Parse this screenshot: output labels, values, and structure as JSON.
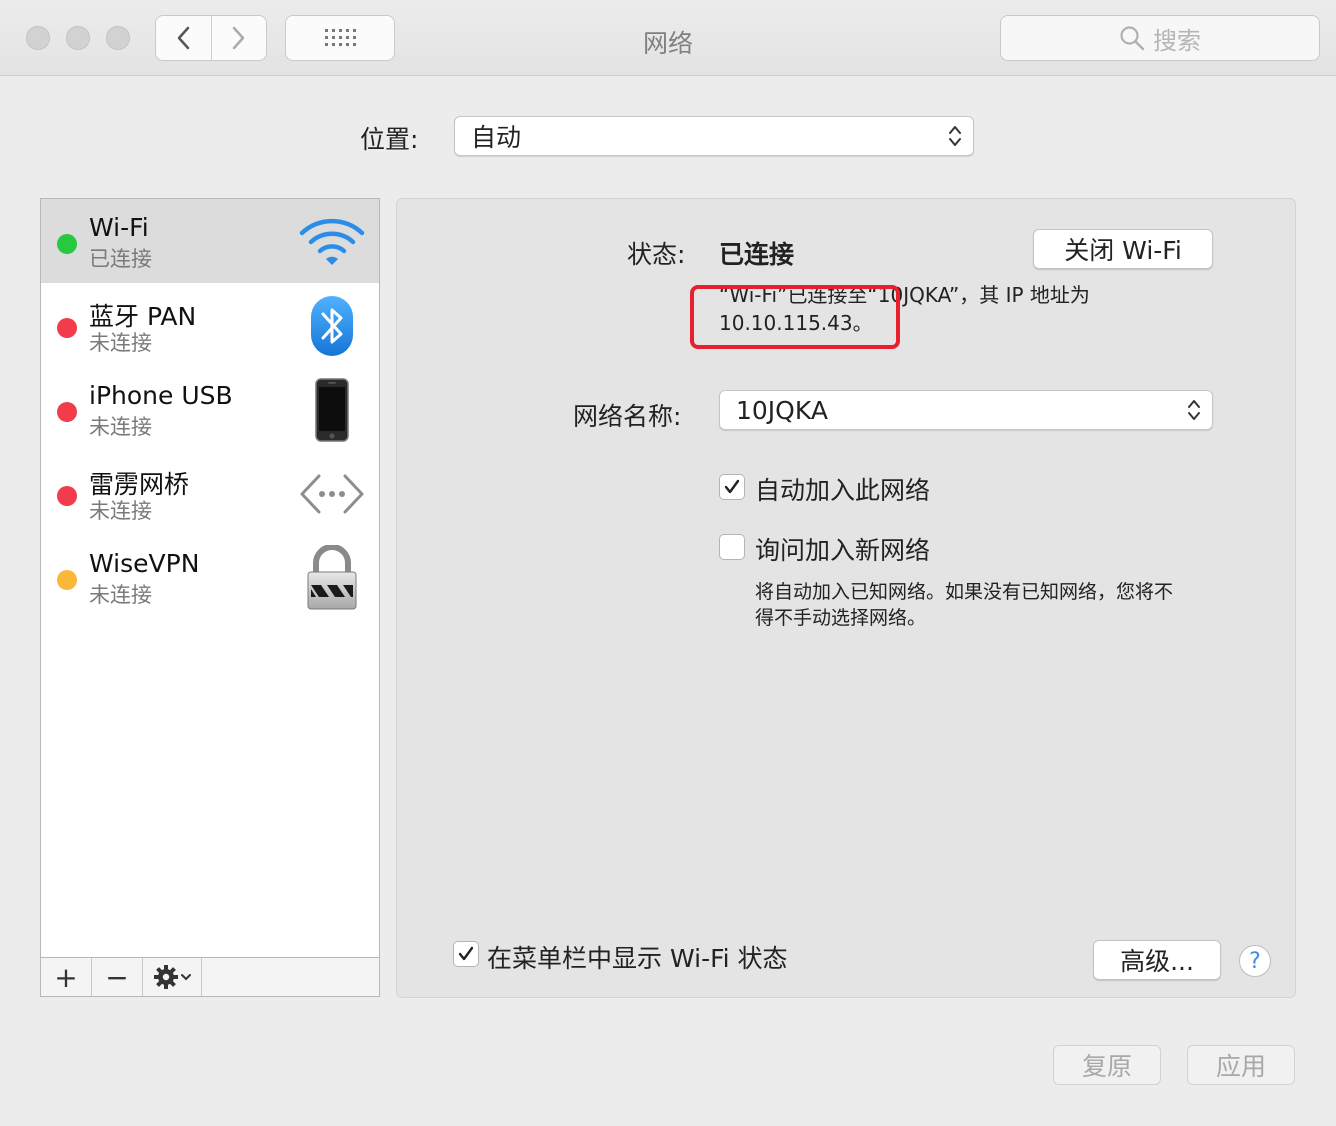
{
  "window": {
    "title": "网络",
    "search_placeholder": "搜索"
  },
  "location": {
    "label": "位置:",
    "value": "自动"
  },
  "services": [
    {
      "name": "Wi-Fi",
      "status": "已连接",
      "color": "#28c840",
      "icon": "wifi-icon",
      "selected": true
    },
    {
      "name": "蓝牙 PAN",
      "status": "未连接",
      "color": "#f23b4b",
      "icon": "bluetooth-icon",
      "selected": false
    },
    {
      "name": "iPhone USB",
      "status": "未连接",
      "color": "#f23b4b",
      "icon": "iphone-icon",
      "selected": false
    },
    {
      "name": "雷雳网桥",
      "status": "未连接",
      "color": "#f23b4b",
      "icon": "thunderbolt-bridge-icon",
      "selected": false
    },
    {
      "name": "WiseVPN",
      "status": "未连接",
      "color": "#fbb73a",
      "icon": "vpn-lock-icon",
      "selected": false
    }
  ],
  "list_toolbar": {
    "add": "+",
    "remove": "−"
  },
  "detail": {
    "status_label": "状态:",
    "status_value": "已连接",
    "toggle_wifi_button": "关闭 Wi-Fi",
    "status_desc_line1": "“Wi-Fi”已连接至“10JQKA”，其 IP 地址为",
    "status_desc_line2": "10.10.115.43。",
    "network_name_label": "网络名称:",
    "network_name_value": "10JQKA",
    "auto_join_label": "自动加入此网络",
    "auto_join_checked": true,
    "ask_join_label": "询问加入新网络",
    "ask_join_checked": false,
    "ask_join_note_line1": "将自动加入已知网络。如果没有已知网络，您将不",
    "ask_join_note_line2": "得不手动选择网络。",
    "show_in_menubar_label": "在菜单栏中显示 Wi-Fi 状态",
    "show_in_menubar_checked": true,
    "advanced_button": "高级...",
    "help": "?"
  },
  "footer": {
    "revert_button": "复原",
    "apply_button": "应用"
  },
  "highlight_color": "#e8202e"
}
